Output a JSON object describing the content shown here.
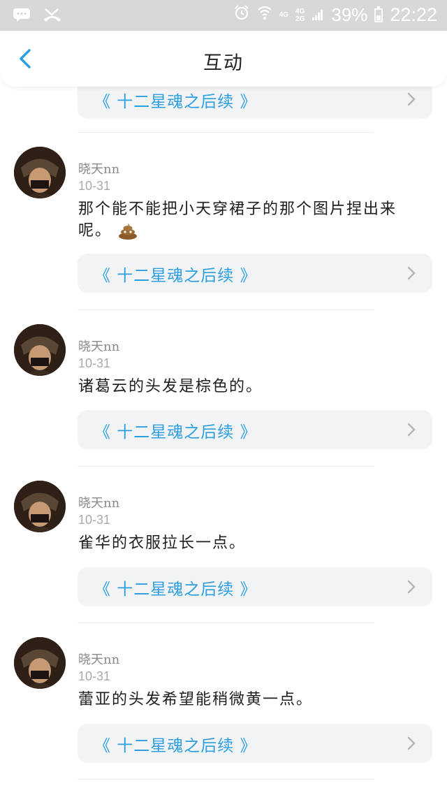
{
  "status_bar": {
    "network_top": "4G",
    "network_bottom_a": "4G",
    "network_bottom_b": "2G",
    "battery": "39%",
    "battery_level": 0.39,
    "time": "22:22"
  },
  "header": {
    "title": "互动"
  },
  "feed": {
    "top_card": {
      "story_title": "《 十二星魂之后续 》"
    },
    "posts": [
      {
        "author": "晓天nn",
        "date": "10-31",
        "comment": "那个能不能把小天穿裙子的那个图片捏出来呢。",
        "story_title": "《 十二星魂之后续 》"
      },
      {
        "author": "晓天nn",
        "date": "10-31",
        "comment": "诸葛云的头发是棕色的。",
        "story_title": "《 十二星魂之后续 》"
      },
      {
        "author": "晓天nn",
        "date": "10-31",
        "comment": "雀华的衣服拉长一点。",
        "story_title": "《 十二星魂之后续 》"
      },
      {
        "author": "晓天nn",
        "date": "10-31",
        "comment": "蕾亚的头发希望能稍微黄一点。",
        "story_title": "《 十二星魂之后续 》"
      }
    ]
  },
  "colors": {
    "accent": "#2d9fe0",
    "status_bar_bg": "#d8d8d8",
    "card_bg": "#f2f3f5"
  }
}
